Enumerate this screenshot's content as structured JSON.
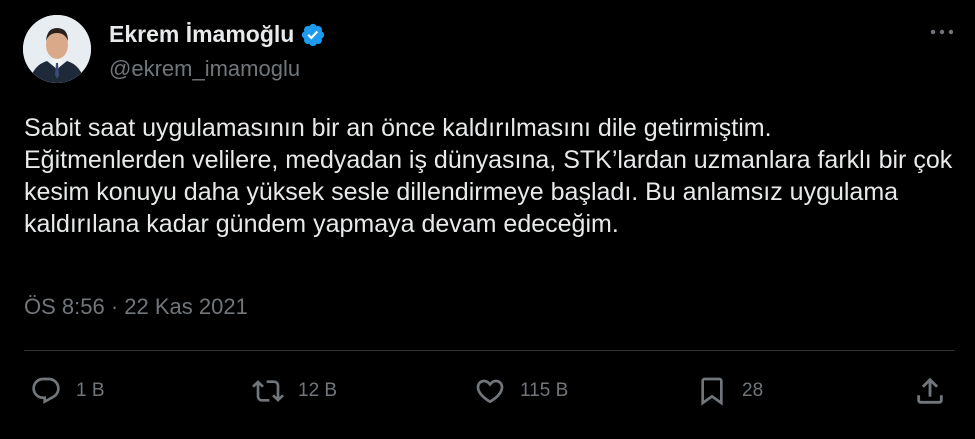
{
  "author": {
    "display_name": "Ekrem İmamoğlu",
    "handle": "@ekrem_imamoglu",
    "verified": true,
    "verified_color": "#1d9bf0"
  },
  "tweet": {
    "text": "Sabit saat uygulamasının bir an önce kaldırılmasını dile getirmiştim.\nEğitmenlerden velilere, medyadan iş dünyasına, STK’lardan uzmanlara farklı bir çok kesim konuyu daha yüksek sesle dillendirmeye başladı. Bu anlamsız uygulama kaldırılana kadar gündem yapmaya devam edeceğim.",
    "time": "ÖS 8:56",
    "separator": "·",
    "date": "22 Kas 2021"
  },
  "actions": {
    "reply_count": "1 B",
    "retweet_count": "12 B",
    "like_count": "115 B",
    "bookmark_count": "28"
  },
  "icons": {
    "more": "more-dots-icon",
    "reply": "reply-bubble-icon",
    "retweet": "retweet-icon",
    "like": "heart-icon",
    "bookmark": "bookmark-icon",
    "share": "share-icon"
  },
  "colors": {
    "background": "#000000",
    "text": "#e7e9ea",
    "secondary": "#71767b",
    "divider": "#2f3336"
  }
}
